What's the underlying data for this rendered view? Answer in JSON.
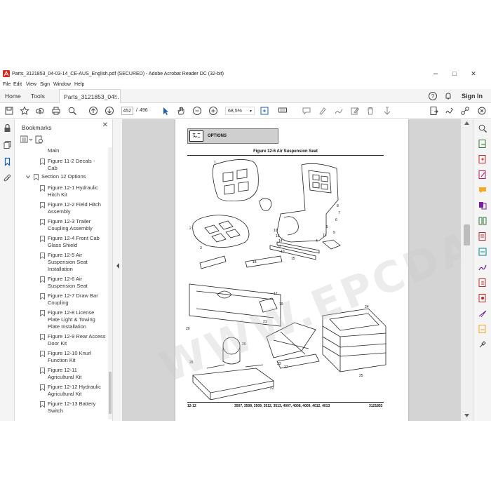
{
  "window": {
    "title": "Parts_3121853_04-03-14_CE-AUS_English.pdf (SECURED) - Adobe Acrobat Reader DC (32-bit)",
    "controls": [
      "–",
      "□",
      "✕"
    ]
  },
  "menu": [
    "File",
    "Edit",
    "View",
    "Sign",
    "Window",
    "Help"
  ],
  "tabs": {
    "home": "Home",
    "tools": "Tools",
    "document": "Parts_3121853_04...",
    "close": "×",
    "signin": "Sign In"
  },
  "toolbar": {
    "page_current": "452",
    "page_sep": "/",
    "page_total": "496",
    "zoom": "68,5%"
  },
  "bookmarks": {
    "header": "Bookmarks",
    "close": "✕",
    "items": [
      {
        "text": "Main",
        "line2": ""
      },
      {
        "text": "Figure 11-2 Decals -",
        "line2": "Cab"
      },
      {
        "text": "Section 12 Options",
        "line2": ""
      },
      {
        "text": "Figure 12-1 Hydraulic",
        "line2": "Hitch Kit"
      },
      {
        "text": "Figure 12-2 Field Hitch",
        "line2": "Assembly"
      },
      {
        "text": "Figure 12-3 Trailer",
        "line2": "Coupling Assembly"
      },
      {
        "text": "Figure 12-4 Front Cab",
        "line2": "Glass Shield"
      },
      {
        "text": "Figure 12-5 Air",
        "line2": "Suspension Seat",
        "line3": "Installation"
      },
      {
        "text": "Figure 12-6 Air",
        "line2": "Suspension Seat"
      },
      {
        "text": "Figure 12-7 Draw Bar",
        "line2": "Coupling"
      },
      {
        "text": "Figure 12-8 License",
        "line2": "Plate Light & Towing",
        "line3": "Plate Installation"
      },
      {
        "text": "Figure 12-9 Rear Access",
        "line2": "Door Kit"
      },
      {
        "text": "Figure 12-10 Knurl",
        "line2": "Function Kit"
      },
      {
        "text": "Figure 12-11",
        "line2": "Agricultural Kit"
      },
      {
        "text": "Figure 12-12 Hydraulic",
        "line2": "Agricultural Kit"
      },
      {
        "text": "Figure 12-13 Battery",
        "line2": "Switch"
      }
    ]
  },
  "page": {
    "section": "OPTIONS",
    "figure_title": "Figure 12-6 Air Suspension Seat",
    "footer_left": "12-12",
    "footer_center": "3507, 3508, 3509, 3512, 3513, 4007, 4008, 4009, 4012, 4013",
    "footer_right": "3121853",
    "callouts": [
      "1",
      "2",
      "3",
      "4",
      "5",
      "6",
      "7",
      "8",
      "9",
      "10",
      "11",
      "12",
      "13",
      "14",
      "15",
      "16",
      "17",
      "18",
      "19",
      "20",
      "21",
      "22",
      "23",
      "24",
      "25",
      "26",
      "27",
      "28"
    ],
    "watermark": "WWW.EPCDATA.COM"
  },
  "icons": {
    "save": "save-icon",
    "bookmark_star": "star-icon",
    "upload": "upload-icon",
    "print": "print-icon",
    "search": "search-icon"
  }
}
